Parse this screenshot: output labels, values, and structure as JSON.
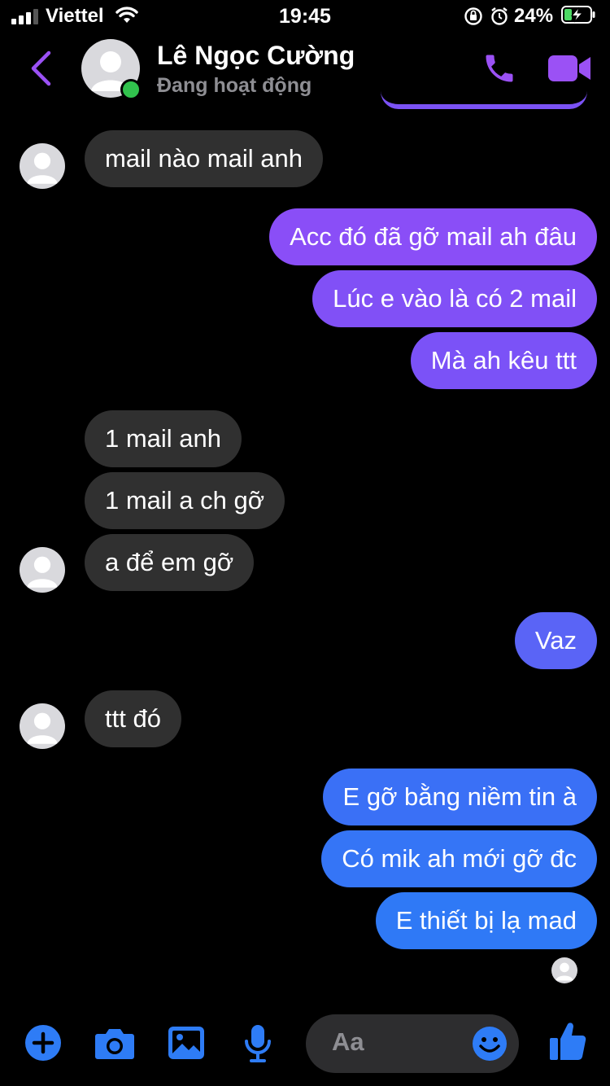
{
  "status_bar": {
    "carrier": "Viettel",
    "time": "19:45",
    "battery": "24%"
  },
  "header": {
    "contact_name": "Lê Ngọc Cường",
    "presence": "Đang hoạt động",
    "accent": "#9b51f5"
  },
  "messages": [
    {
      "from": "in",
      "text": "mail nào mail anh"
    },
    {
      "from": "out",
      "text": "Acc đó đã gỡ mail ah đâu"
    },
    {
      "from": "out",
      "text": "Lúc e vào là có 2 mail"
    },
    {
      "from": "out",
      "text": "Mà ah kêu ttt"
    },
    {
      "from": "in",
      "text": "1 mail anh"
    },
    {
      "from": "in",
      "text": "1 mail a ch gỡ"
    },
    {
      "from": "in",
      "text": "a để em gỡ"
    },
    {
      "from": "out",
      "text": "Vaz"
    },
    {
      "from": "in",
      "text": "ttt đó"
    },
    {
      "from": "out",
      "text": "E gỡ bằng niềm tin à"
    },
    {
      "from": "out",
      "text": "Có mik ah mới gỡ đc"
    },
    {
      "from": "out",
      "text": "E thiết bị lạ mad"
    }
  ],
  "composer": {
    "placeholder": "Aa",
    "icons": [
      "plus-icon",
      "camera-icon",
      "image-icon",
      "microphone-icon",
      "emoji-icon",
      "thumbs-up-icon"
    ],
    "accent": "#2e7cf6"
  }
}
